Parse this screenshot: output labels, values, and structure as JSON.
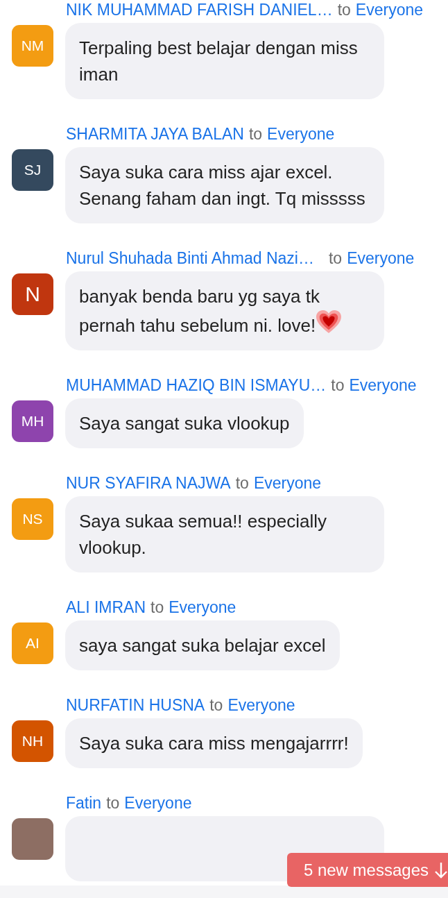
{
  "messages": [
    {
      "sender": "NIK MUHAMMAD FARISH DANIEL…",
      "to": "to",
      "recipient": "Everyone",
      "initials": "NM",
      "color": "#f39c12",
      "text": "Terpaling best belajar dengan miss iman"
    },
    {
      "sender": "SHARMITA JAYA BALAN",
      "to": "to",
      "recipient": "Everyone",
      "initials": "SJ",
      "color": "#34495e",
      "text": "Saya suka cara miss ajar excel. Senang faham dan ingt. Tq misssss"
    },
    {
      "sender": "Nurul Shuhada Binti Ahmad Nazi…",
      "to": "to",
      "recipient": "Everyone",
      "initials": "N",
      "color": "#c0360f",
      "text": "banyak benda baru yg saya tk pernah tahu sebelum ni. love!",
      "heart": true
    },
    {
      "sender": "MUHAMMAD HAZIQ BIN ISMAYU…",
      "to": "to",
      "recipient": "Everyone",
      "initials": "MH",
      "color": "#8e44ad",
      "text": "Saya sangat suka vlookup"
    },
    {
      "sender": "NUR SYAFIRA NAJWA",
      "to": "to",
      "recipient": "Everyone",
      "initials": "NS",
      "color": "#f39c12",
      "text": "Saya sukaa semua!! especially vlookup."
    },
    {
      "sender": "ALI IMRAN",
      "to": "to",
      "recipient": "Everyone",
      "initials": "AI",
      "color": "#f39c12",
      "text": "saya sangat suka belajar excel"
    },
    {
      "sender": "NURFATIN HUSNA",
      "to": "to",
      "recipient": "Everyone",
      "initials": "NH",
      "color": "#d35400",
      "text": "Saya suka cara miss mengajarrrr!"
    },
    {
      "sender": "Fatin",
      "to": "to",
      "recipient": "Everyone",
      "color": "#8d6e63"
    }
  ],
  "new_messages": {
    "label": "5 new messages"
  }
}
